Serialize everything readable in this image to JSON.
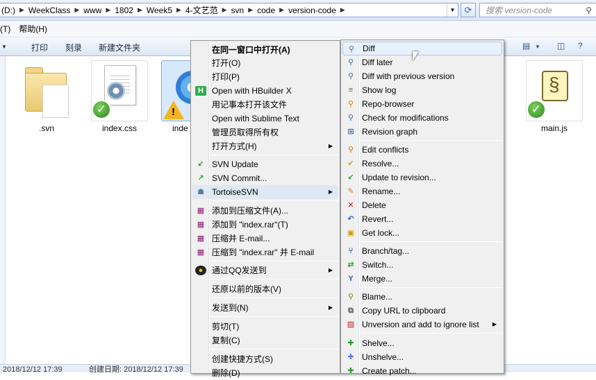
{
  "address": {
    "crumbs": [
      "(D:)",
      "WeekClass",
      "www",
      "1802",
      "Week5",
      "4-文艺范",
      "svn",
      "code",
      "version-code"
    ],
    "search_placeholder": "搜索 version-code"
  },
  "menubar": {
    "item_t": "(T)",
    "help": "帮助(H)"
  },
  "toolbar": {
    "print": "打印",
    "burn": "刻录",
    "new_folder": "新建文件夹"
  },
  "files": [
    {
      "name": ".svn"
    },
    {
      "name": "index.css"
    },
    {
      "name": "inde"
    },
    {
      "name": "main.js"
    }
  ],
  "status": {
    "left": "2018/12/12 17:39",
    "created": "创建日期: 2018/12/12 17:39"
  },
  "main_menu": {
    "items": [
      {
        "label": "在同一窗口中打开(A)"
      },
      {
        "label": "打开(O)"
      },
      {
        "label": "打印(P)"
      },
      {
        "label": "Open with HBuilder X",
        "icon_text": "H"
      },
      {
        "label": "用记事本打开该文件"
      },
      {
        "label": "Open with Sublime Text"
      },
      {
        "label": "管理员取得所有权"
      },
      {
        "label": "打开方式(H)"
      },
      {
        "label": "SVN Update"
      },
      {
        "label": "SVN Commit..."
      },
      {
        "label": "TortoiseSVN"
      },
      {
        "label": "添加到压缩文件(A)..."
      },
      {
        "label": "添加到 \"index.rar\"(T)"
      },
      {
        "label": "压缩并 E-mail..."
      },
      {
        "label": "压缩到 \"index.rar\" 并 E-mail"
      },
      {
        "label": "通过QQ发送到"
      },
      {
        "label": "还原以前的版本(V)"
      },
      {
        "label": "发送到(N)"
      },
      {
        "label": "剪切(T)"
      },
      {
        "label": "复制(C)"
      },
      {
        "label": "创建快捷方式(S)"
      },
      {
        "label": "删除(D)"
      }
    ]
  },
  "svn_menu": {
    "items": [
      {
        "label": "Diff"
      },
      {
        "label": "Diff later"
      },
      {
        "label": "Diff with previous version"
      },
      {
        "label": "Show log"
      },
      {
        "label": "Repo-browser"
      },
      {
        "label": "Check for modifications"
      },
      {
        "label": "Revision graph"
      },
      {
        "label": "Edit conflicts"
      },
      {
        "label": "Resolve..."
      },
      {
        "label": "Update to revision..."
      },
      {
        "label": "Rename..."
      },
      {
        "label": "Delete"
      },
      {
        "label": "Revert..."
      },
      {
        "label": "Get lock..."
      },
      {
        "label": "Branch/tag..."
      },
      {
        "label": "Switch..."
      },
      {
        "label": "Merge..."
      },
      {
        "label": "Blame..."
      },
      {
        "label": "Copy URL to clipboard"
      },
      {
        "label": "Unversion and add to ignore list"
      },
      {
        "label": "Shelve..."
      },
      {
        "label": "Unshelve..."
      },
      {
        "label": "Create patch..."
      }
    ]
  }
}
